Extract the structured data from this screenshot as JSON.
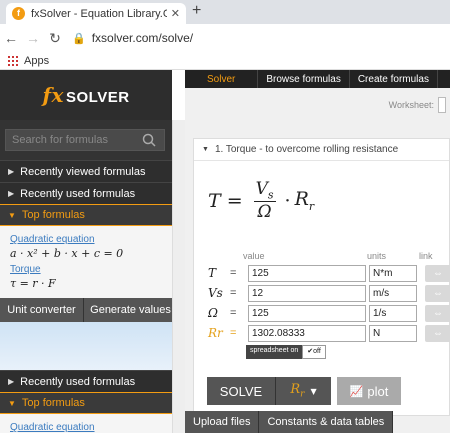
{
  "browser": {
    "tab_title": "fxSolver - Equation Library.Graph",
    "tab_favicon": "fx-logo-icon",
    "close_glyph": "✕",
    "new_tab_glyph": "+",
    "url": "fxsolver.com/solve/",
    "bookmarks": {
      "apps_label": "Apps"
    }
  },
  "sidebar": {
    "logo": {
      "fx": "fx",
      "name": "SOLVER"
    },
    "search_placeholder": "Search for formulas",
    "menu_top": [
      {
        "label": "Recently viewed formulas"
      },
      {
        "label": "Recently used formulas"
      },
      {
        "label": "Top formulas"
      }
    ],
    "formulas": [
      {
        "name": "Quadratic equation",
        "expr": "a · x² + b · x + c = 0"
      },
      {
        "name": "Torque",
        "expr": "τ = r · F"
      }
    ],
    "tools": {
      "unit_converter": "Unit converter",
      "generate_values": "Generate values"
    },
    "menu_bottom": [
      {
        "label": "Recently used formulas"
      },
      {
        "label": "Top formulas"
      }
    ],
    "formula_bottom": {
      "name": "Quadratic equation"
    }
  },
  "topnav": {
    "solver": "Solver",
    "browse": "Browse formulas",
    "create": "Create formulas"
  },
  "worksheet": {
    "label": "Worksheet:"
  },
  "panel": {
    "title": "1. Torque - to overcome rolling resistance",
    "columns": {
      "value": "value",
      "units": "units",
      "link": "link"
    },
    "rows": [
      {
        "var": "T",
        "value": "125",
        "unit": "N*m"
      },
      {
        "var": "Vs",
        "value": "12",
        "unit": "m/s"
      },
      {
        "var": "Ω",
        "value": "125",
        "unit": "1/s"
      },
      {
        "var": "Rr",
        "value": "1302.08333",
        "unit": "N"
      }
    ],
    "spreadsheet": {
      "on": "spreadsheet on",
      "off": "✔off"
    }
  },
  "actions": {
    "solve": "SOLVE",
    "plot": "plot"
  },
  "bottom_tabs": {
    "upload": "Upload files",
    "constants": "Constants & data tables"
  },
  "colors": {
    "accent": "#f39c12",
    "result": "#e4a11b",
    "link": "#3b7bbf"
  }
}
